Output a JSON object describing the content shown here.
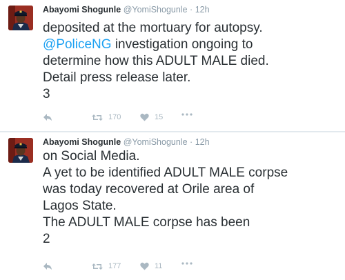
{
  "tweets": [
    {
      "author": {
        "name": "Abayomi Shogunle",
        "handle": "@YomiShogunle",
        "time": "12h"
      },
      "separator": "·",
      "mention": "@PoliceNG",
      "lines": [
        "deposited at the mortuary for autopsy.",
        " investigation ongoing to",
        "determine how this ADULT MALE died.",
        "Detail press release later.",
        "3"
      ],
      "counts": {
        "retweets": "170",
        "likes": "15"
      }
    },
    {
      "author": {
        "name": "Abayomi Shogunle",
        "handle": "@YomiShogunle",
        "time": "12h"
      },
      "separator": "·",
      "lines": [
        "on Social Media.",
        "A yet to be identified ADULT MALE corpse",
        "was today recovered at Orile area of",
        "Lagos State.",
        "The ADULT MALE corpse has been",
        "2"
      ],
      "counts": {
        "retweets": "177",
        "likes": "11"
      }
    }
  ],
  "icons": {
    "reply": "reply-icon",
    "retweet": "retweet-icon",
    "like": "heart-icon",
    "more": "more-icon",
    "avatar": "avatar-police-officer"
  },
  "colors": {
    "text": "#292f33",
    "muted": "#8899a6",
    "link": "#1da1f2",
    "action_icon": "#aab8c2",
    "divider": "#e1e8ed"
  }
}
